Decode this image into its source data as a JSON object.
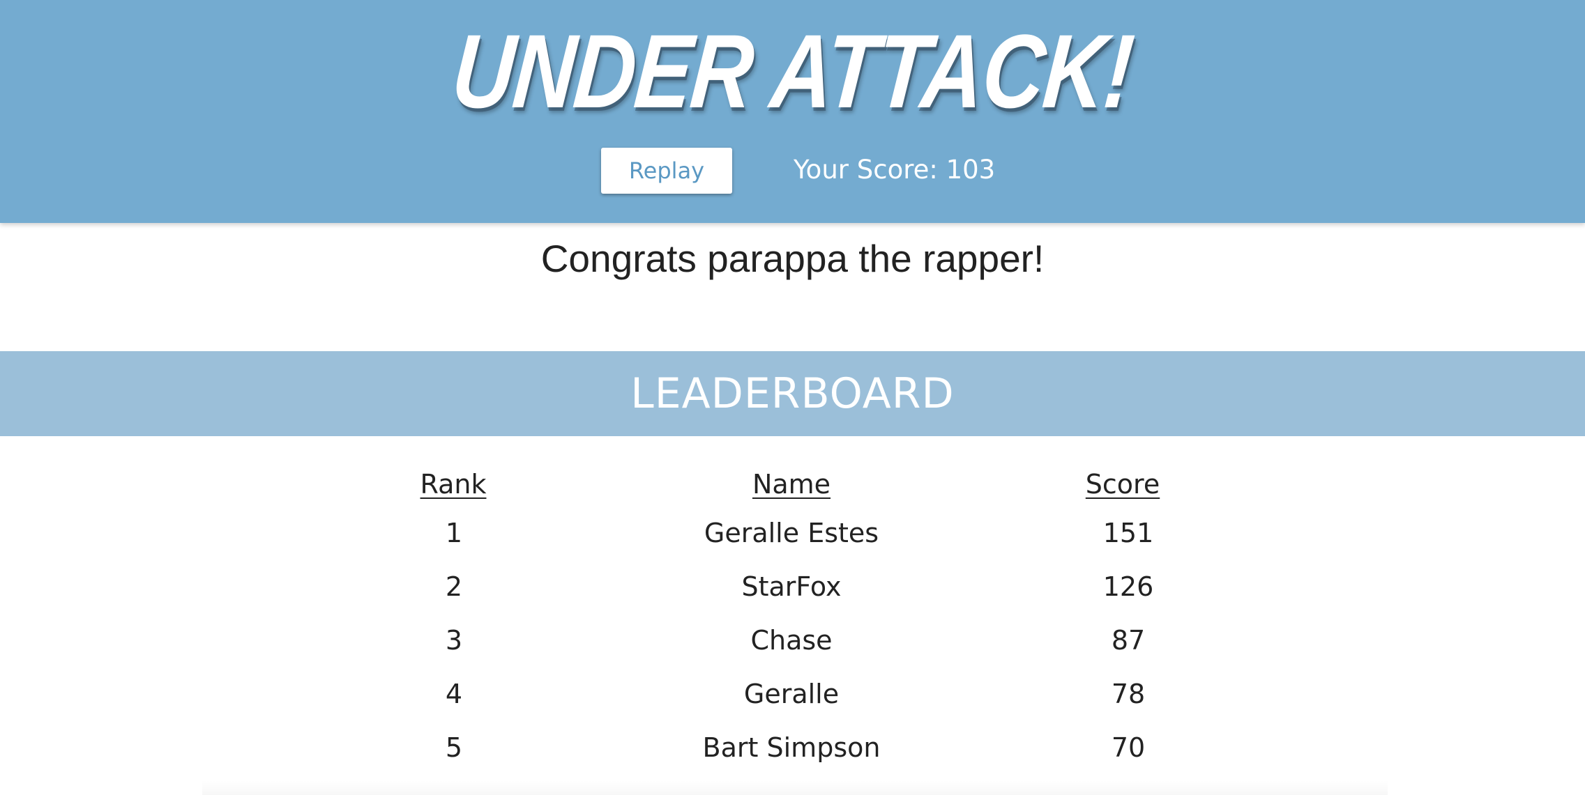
{
  "header": {
    "title": "UNDER ATTACK!",
    "replay_label": "Replay",
    "score_text": "Your Score: 103"
  },
  "congrats_text": "Congrats parappa the rapper!",
  "leaderboard": {
    "title": "LEADERBOARD",
    "columns": [
      "Rank",
      "Name",
      "Score"
    ],
    "rows": [
      {
        "rank": "1",
        "name": "Geralle Estes",
        "score": "151"
      },
      {
        "rank": "2",
        "name": "StarFox",
        "score": "126"
      },
      {
        "rank": "3",
        "name": "Chase",
        "score": "87"
      },
      {
        "rank": "4",
        "name": "Geralle",
        "score": "78"
      },
      {
        "rank": "5",
        "name": "Bart Simpson",
        "score": "70"
      }
    ]
  },
  "colors": {
    "header_bg": "#74abd0",
    "banner_bg": "#9bbfd9",
    "button_text": "#5a98c3",
    "text": "#222222"
  }
}
